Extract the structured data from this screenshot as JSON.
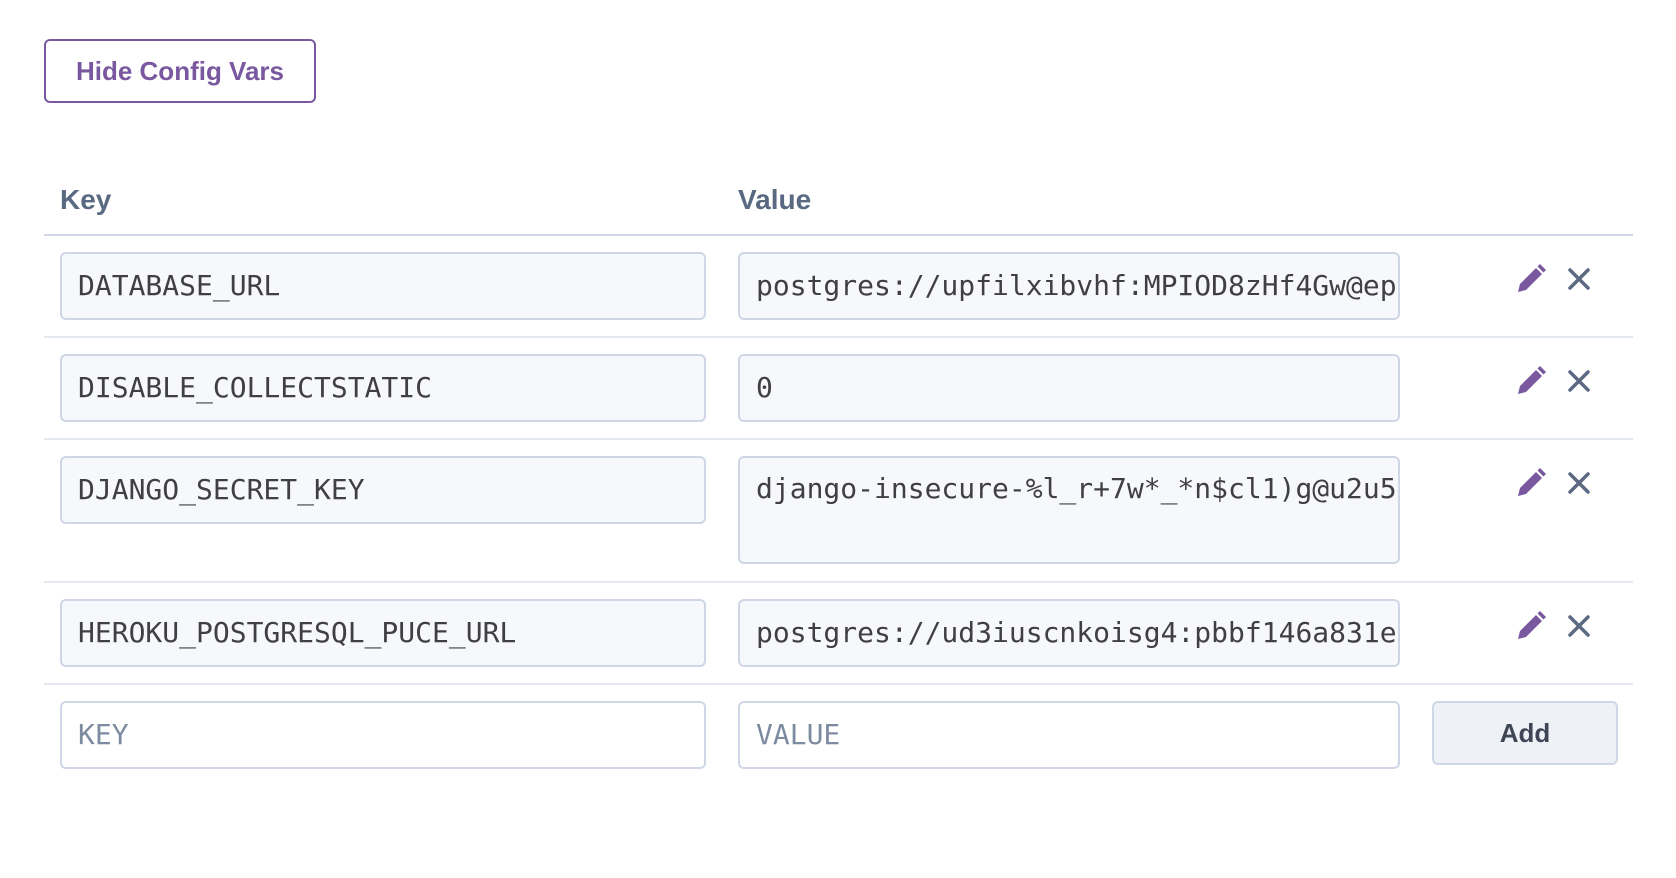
{
  "toggle_button": {
    "label": "Hide Config Vars"
  },
  "table": {
    "headers": {
      "key": "Key",
      "value": "Value"
    },
    "rows": [
      {
        "key": "DATABASE_URL",
        "value": "postgres://upfilxibvhf:MPIOD8zHf4Gw@ep"
      },
      {
        "key": "DISABLE_COLLECTSTATIC",
        "value": "0"
      },
      {
        "key": "DJANGO_SECRET_KEY",
        "value": "django-insecure-%l_r+7w*_*n$cl1)g@u2u5"
      },
      {
        "key": "HEROKU_POSTGRESQL_PUCE_URL",
        "value": "postgres://ud3iuscnkoisg4:pbbf146a831e"
      }
    ],
    "new_row": {
      "key_placeholder": "KEY",
      "value_placeholder": "VALUE",
      "add_label": "Add"
    }
  },
  "colors": {
    "accent": "#79589f",
    "icon": "#5b6a82",
    "border": "#cfd7e6"
  },
  "icons": {
    "edit": "pencil-icon",
    "delete": "close-icon"
  }
}
